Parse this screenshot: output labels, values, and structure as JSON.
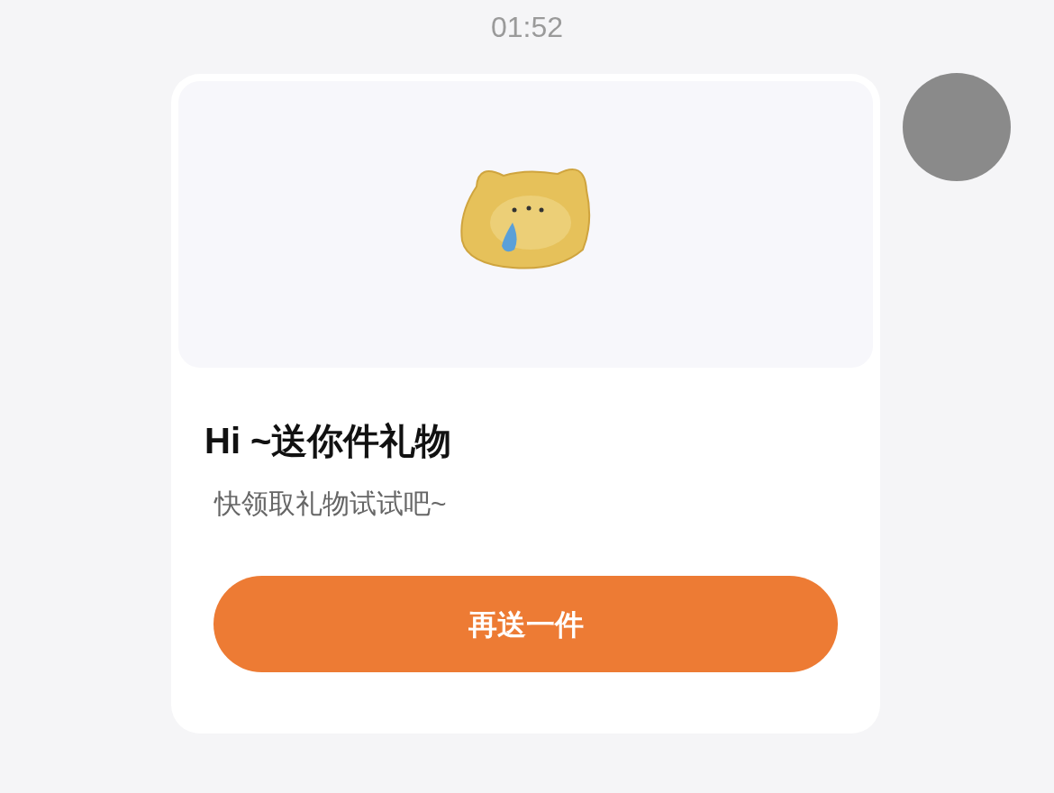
{
  "time": "01:52",
  "message": {
    "title": "Hi ~送你件礼物",
    "subtitle": "快领取礼物试试吧~",
    "button": "再送一件"
  }
}
